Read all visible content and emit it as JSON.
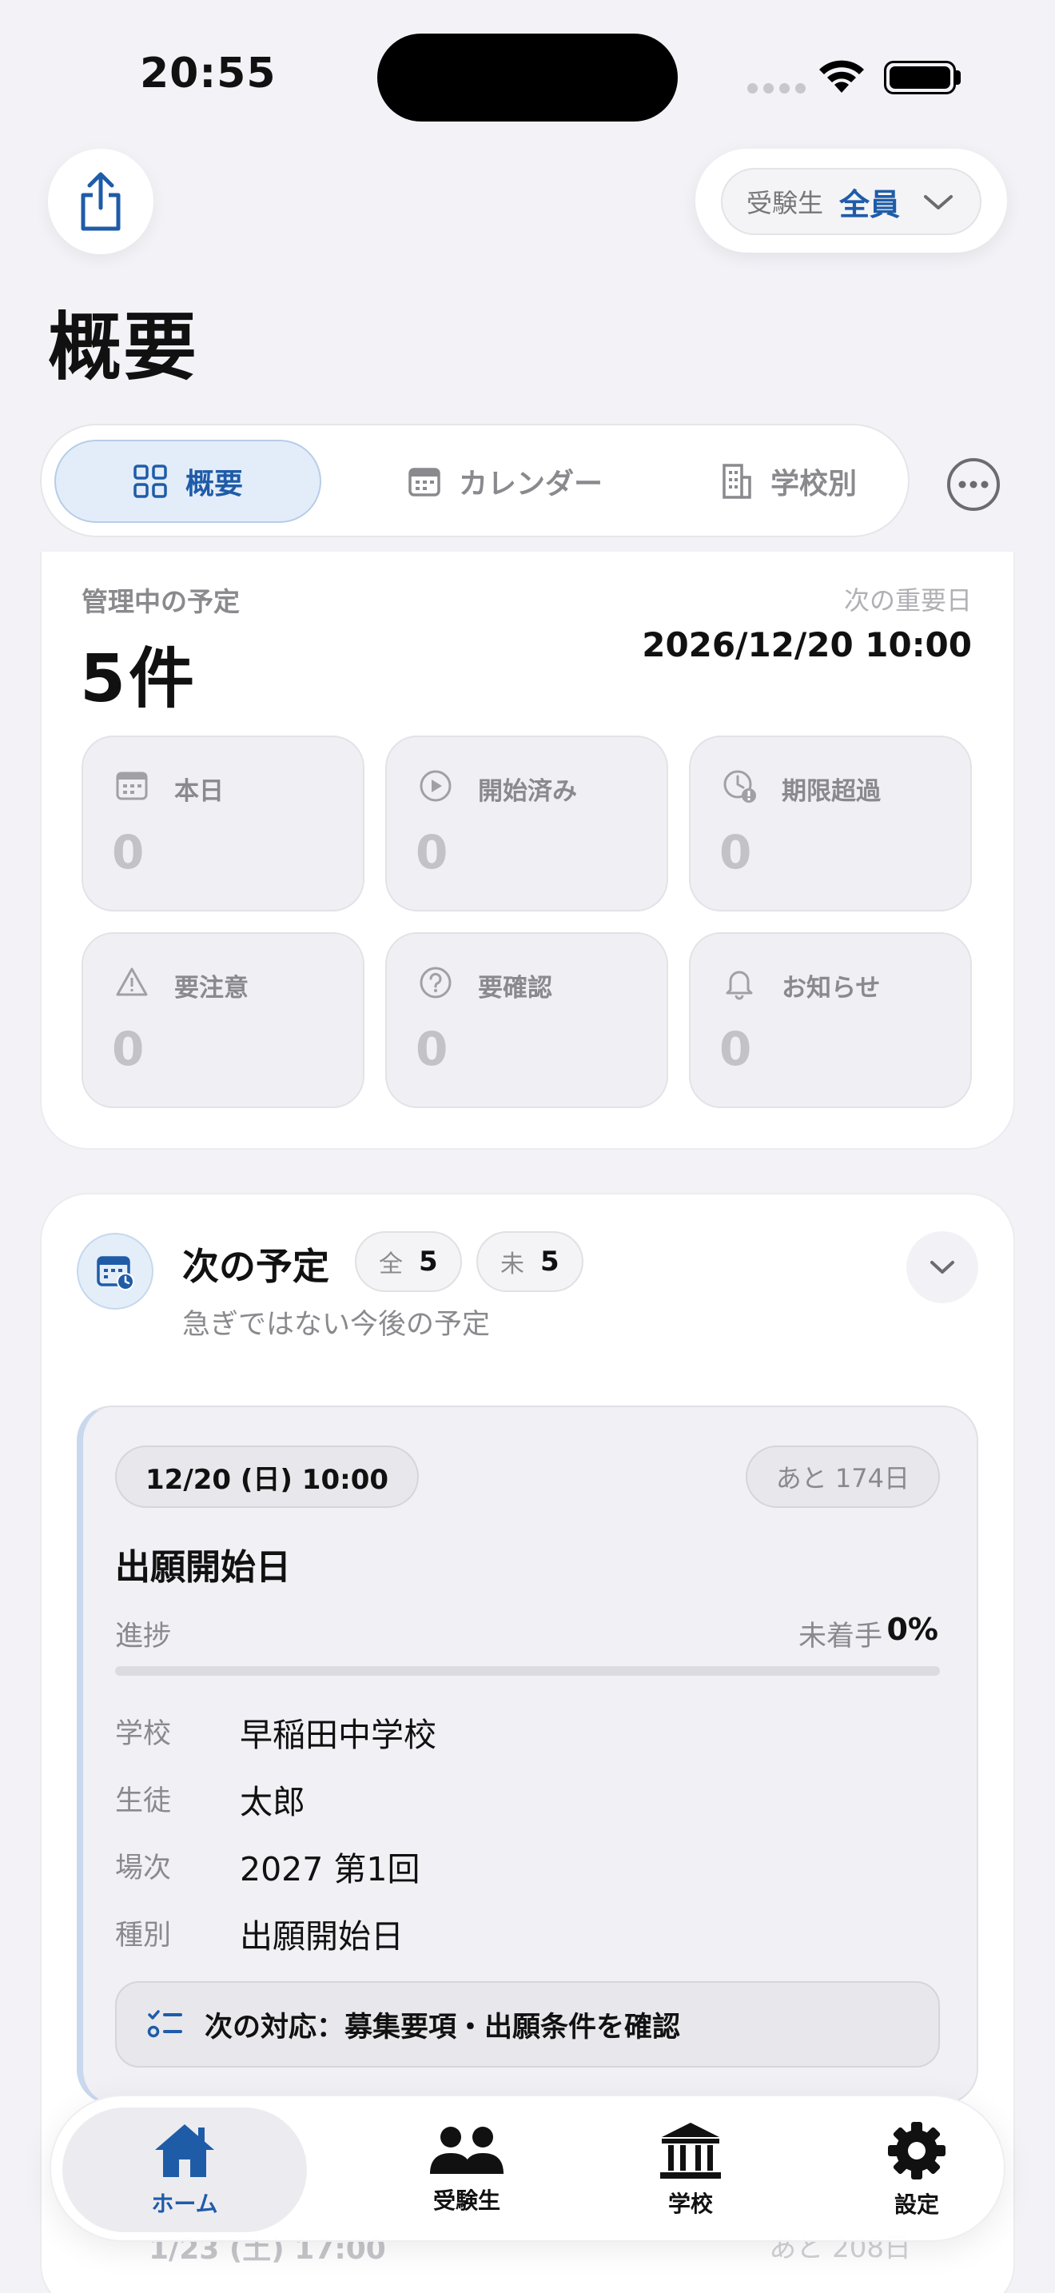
{
  "status_bar": {
    "time": "20:55"
  },
  "header": {
    "filter_label": "受験生",
    "filter_value": "全員",
    "page_title": "概要"
  },
  "tabs": [
    {
      "label": "概要",
      "icon": "grid-icon",
      "active": true
    },
    {
      "label": "カレンダー",
      "icon": "calendar-icon",
      "active": false
    },
    {
      "label": "学校別",
      "icon": "building-icon",
      "active": false
    }
  ],
  "summary": {
    "label": "管理中の予定",
    "count": "5件",
    "next_label": "次の重要日",
    "next_date": "2026/12/20 10:00",
    "stats": [
      {
        "label": "本日",
        "value": "0",
        "icon": "calendar-icon"
      },
      {
        "label": "開始済み",
        "value": "0",
        "icon": "play-icon"
      },
      {
        "label": "期限超過",
        "value": "0",
        "icon": "clock-alert-icon"
      },
      {
        "label": "要注意",
        "value": "0",
        "icon": "warning-icon"
      },
      {
        "label": "要確認",
        "value": "0",
        "icon": "question-icon"
      },
      {
        "label": "お知らせ",
        "value": "0",
        "icon": "bell-icon"
      }
    ]
  },
  "upcoming": {
    "title": "次の予定",
    "chip_all_label": "全",
    "chip_all_value": "5",
    "chip_pending_label": "未",
    "chip_pending_value": "5",
    "subtitle": "急ぎではない今後の予定",
    "event": {
      "date": "12/20 (日) 10:00",
      "days_left": "あと 174日",
      "title": "出願開始日",
      "progress_label": "進捗",
      "progress_status": "未着手",
      "progress_pct": "0%",
      "progress_value": 0,
      "rows": [
        {
          "key": "学校",
          "value": "早稲田中学校"
        },
        {
          "key": "生徒",
          "value": "太郎"
        },
        {
          "key": "場次",
          "value": "2027 第1回"
        },
        {
          "key": "種別",
          "value": "出願開始日"
        }
      ],
      "next_action": "次の対応：募集要項・出願条件を確認"
    },
    "next_event_peek": {
      "date": "1/23 (土) 17:00",
      "days_left": "あと 208日"
    }
  },
  "tab_bar": [
    {
      "label": "ホーム",
      "icon": "home-icon",
      "active": true
    },
    {
      "label": "受験生",
      "icon": "people-icon",
      "active": false
    },
    {
      "label": "学校",
      "icon": "school-icon",
      "active": false
    },
    {
      "label": "設定",
      "icon": "gear-icon",
      "active": false
    }
  ],
  "colors": {
    "accent": "#1f5ca8",
    "background": "#f2f2f7"
  }
}
